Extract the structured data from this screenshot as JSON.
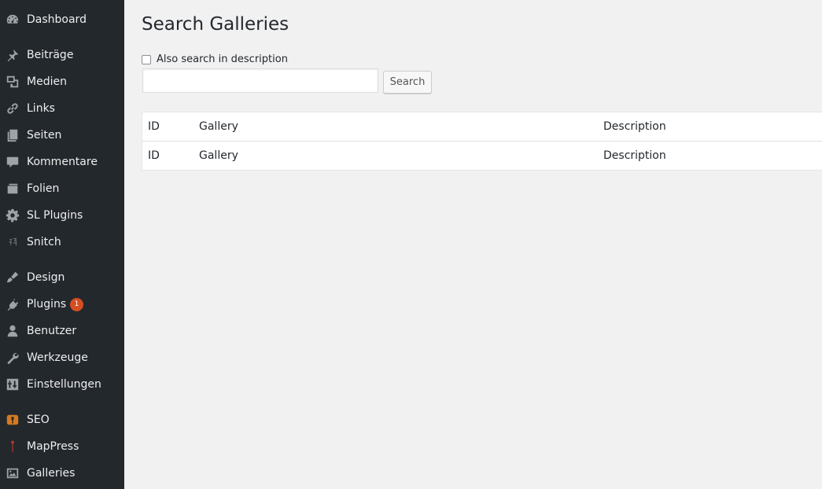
{
  "sidebar": {
    "items": [
      {
        "label": "Dashboard",
        "icon": "dashboard-icon"
      },
      {
        "label": "Beiträge",
        "icon": "pin-icon"
      },
      {
        "label": "Medien",
        "icon": "media-icon"
      },
      {
        "label": "Links",
        "icon": "link-icon"
      },
      {
        "label": "Seiten",
        "icon": "pages-icon"
      },
      {
        "label": "Kommentare",
        "icon": "comment-icon"
      },
      {
        "label": "Folien",
        "icon": "slides-icon"
      },
      {
        "label": "SL Plugins",
        "icon": "gear-icon"
      },
      {
        "label": "Snitch",
        "icon": "snitch-icon"
      },
      {
        "label": "Design",
        "icon": "brush-icon"
      },
      {
        "label": "Plugins",
        "icon": "plug-icon",
        "badge": "1"
      },
      {
        "label": "Benutzer",
        "icon": "user-icon"
      },
      {
        "label": "Werkzeuge",
        "icon": "wrench-icon"
      },
      {
        "label": "Einstellungen",
        "icon": "settings-icon"
      },
      {
        "label": "SEO",
        "icon": "seo-icon"
      },
      {
        "label": "MapPress",
        "icon": "map-pin-icon"
      },
      {
        "label": "Galleries",
        "icon": "gallery-icon"
      }
    ]
  },
  "main": {
    "title": "Search Galleries",
    "checkbox_label": "Also search in description",
    "checkbox_checked": false,
    "search_value": "",
    "search_button": "Search",
    "table": {
      "columns": [
        "ID",
        "Gallery",
        "Description"
      ],
      "footer": [
        "ID",
        "Gallery",
        "Description"
      ]
    }
  },
  "colors": {
    "sidebar_bg": "#23282d",
    "content_bg": "#f1f1f1",
    "badge": "#d54e21",
    "seo_icon": "#d67a1f",
    "mappress_icon": "#c0392b"
  }
}
